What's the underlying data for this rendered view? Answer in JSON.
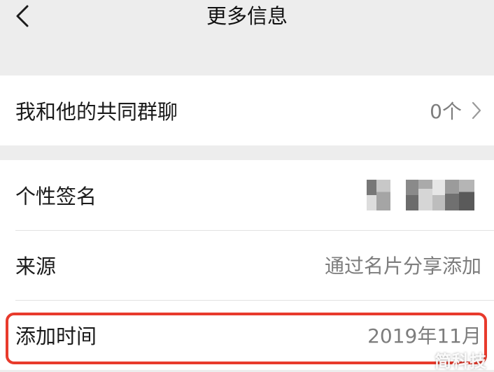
{
  "header": {
    "title": "更多信息",
    "back_icon": "chevron-left-icon"
  },
  "groups": [
    {
      "rows": [
        {
          "label": "我和他的共同群聊",
          "value": "0个",
          "has_chevron": true
        }
      ]
    },
    {
      "rows": [
        {
          "label": "个性签名",
          "value_obscured": true
        },
        {
          "label": "来源",
          "value": "通过名片分享添加"
        },
        {
          "label": "添加时间",
          "value": "2019年11月"
        }
      ]
    }
  ],
  "watermark": "简科技",
  "colors": {
    "background": "#ededed",
    "card": "#ffffff",
    "highlight": "#e83a2c",
    "secondary_text": "#7d7d7d"
  }
}
